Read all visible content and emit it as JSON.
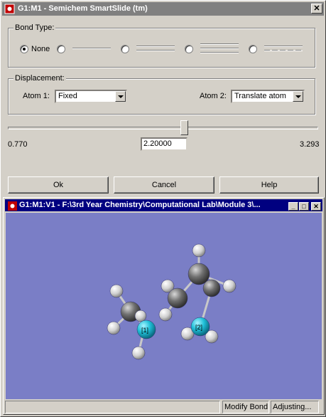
{
  "window": {
    "title": "G1:M1 - Semichem SmartSlide (tm)",
    "close_label": "✕"
  },
  "bond_type": {
    "legend": "Bond Type:",
    "options": [
      {
        "label": "None",
        "selected": true
      },
      {
        "label": "",
        "selected": false,
        "style": "single"
      },
      {
        "label": "",
        "selected": false,
        "style": "double"
      },
      {
        "label": "",
        "selected": false,
        "style": "triple"
      },
      {
        "label": "",
        "selected": false,
        "style": "dashed"
      }
    ]
  },
  "displacement": {
    "legend": "Displacement:",
    "atom1_label": "Atom 1:",
    "atom1_value": "Fixed",
    "atom2_label": "Atom 2:",
    "atom2_value": "Translate atom"
  },
  "slider": {
    "min_label": "0.770",
    "max_label": "3.293",
    "value": "2.20000",
    "min": 0.77,
    "max": 3.293,
    "current": 2.2
  },
  "buttons": {
    "ok": "Ok",
    "cancel": "Cancel",
    "help": "Help"
  },
  "child_window": {
    "title": "G1:M1:V1 - F:\\3rd Year Chemistry\\Computational Lab\\Module 3\\...",
    "min_label": "_",
    "max_label": "□",
    "close_label": "✕",
    "viewport_bg": "#7a7ec6",
    "atom_labels": [
      "[1]",
      "[2]"
    ],
    "status_panels": [
      "",
      "Modify Bond",
      "Adjusting..."
    ]
  },
  "colors": {
    "carbon": "#6e6e6e",
    "hydrogen": "#e6e6e6",
    "nitrogen": "#1fbcd6",
    "title_active": "#000080",
    "title_inactive": "#808080"
  }
}
